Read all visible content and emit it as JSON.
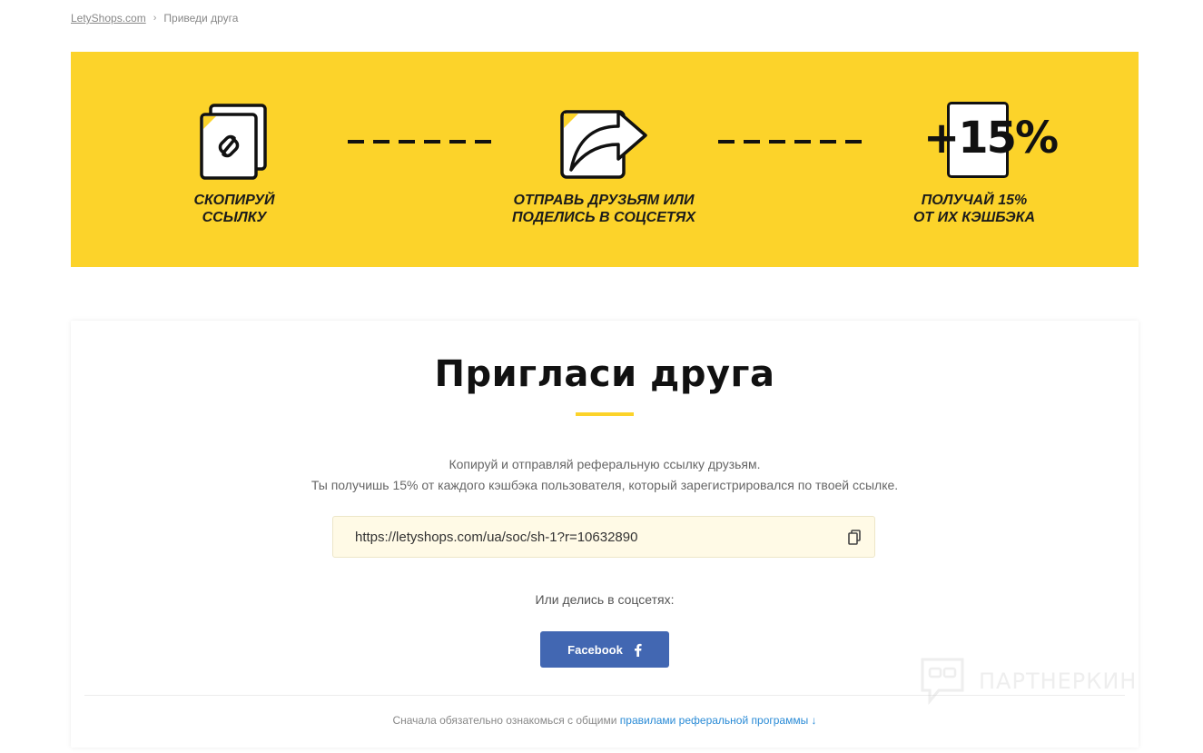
{
  "breadcrumb": {
    "home": "LetyShops.com",
    "separator": "›",
    "current": "Приведи друга"
  },
  "banner": {
    "background": "#fcd32a",
    "steps": [
      {
        "icon": "link-copy-icon",
        "caption": "СКОПИРУЙ\nССЫЛКУ"
      },
      {
        "icon": "share-arrow-icon",
        "caption": "ОТПРАВЬ ДРУЗЬЯМ ИЛИ\nПОДЕЛИСЬ В СОЦСЕТЯХ"
      },
      {
        "icon": "plus-15-percent-icon",
        "caption": "ПОЛУЧАЙ 15%\nОТ ИХ КЭШБЭКА",
        "icon_text": "+15%"
      }
    ]
  },
  "card": {
    "title": "Пригласи друга",
    "desc_line1": "Копируй и отправляй реферальную ссылку друзьям.",
    "desc_line2": "Ты получишь 15% от каждого кэшбэка пользователя, который зарегистрировался по твоей ссылке.",
    "referral_link": "https://letyshops.com/ua/soc/sh-1?r=10632890",
    "share_label": "Или делись в соцсетях:",
    "facebook_label": "Facebook",
    "rules_prefix": "Сначала обязательно ознакомься с общими",
    "rules_link": "правилами реферальной программы ↓"
  },
  "watermark": {
    "text": "ПАРТНЕРКИН"
  },
  "colors": {
    "accent": "#fcd32a",
    "facebook": "#4267b2",
    "link": "#2a8bd6"
  }
}
